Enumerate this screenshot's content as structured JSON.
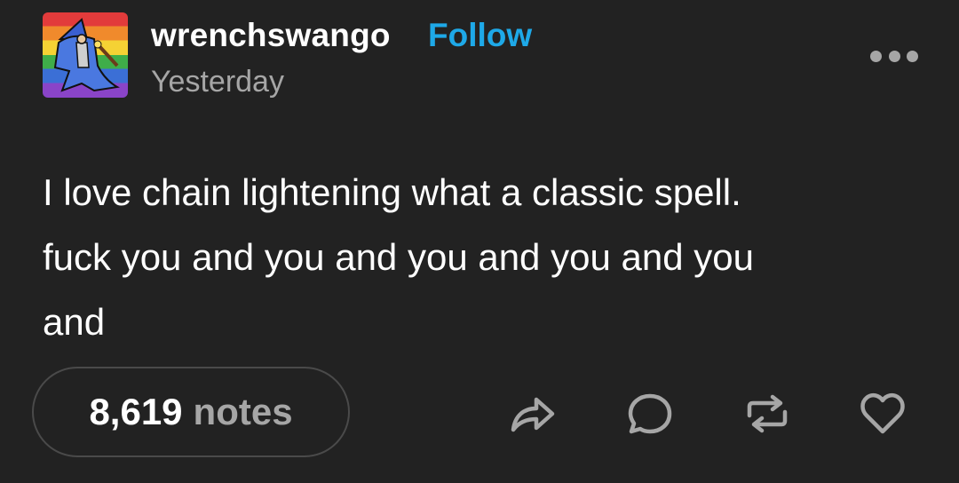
{
  "post": {
    "author": "wrenchswango",
    "follow_label": "Follow",
    "timestamp": "Yesterday",
    "body": "I love chain lightening what a classic spell.\nfuck you and you and you and you and you\nand",
    "notes_count": "8,619",
    "notes_label": "notes"
  },
  "icons": {
    "more": "more-options-icon",
    "share": "share-icon",
    "reply": "reply-icon",
    "reblog": "reblog-icon",
    "like": "heart-icon"
  },
  "colors": {
    "background": "#222222",
    "text": "#ffffff",
    "muted": "#a6a6a6",
    "accent": "#1ea9e8",
    "border": "#4a4a4a"
  }
}
